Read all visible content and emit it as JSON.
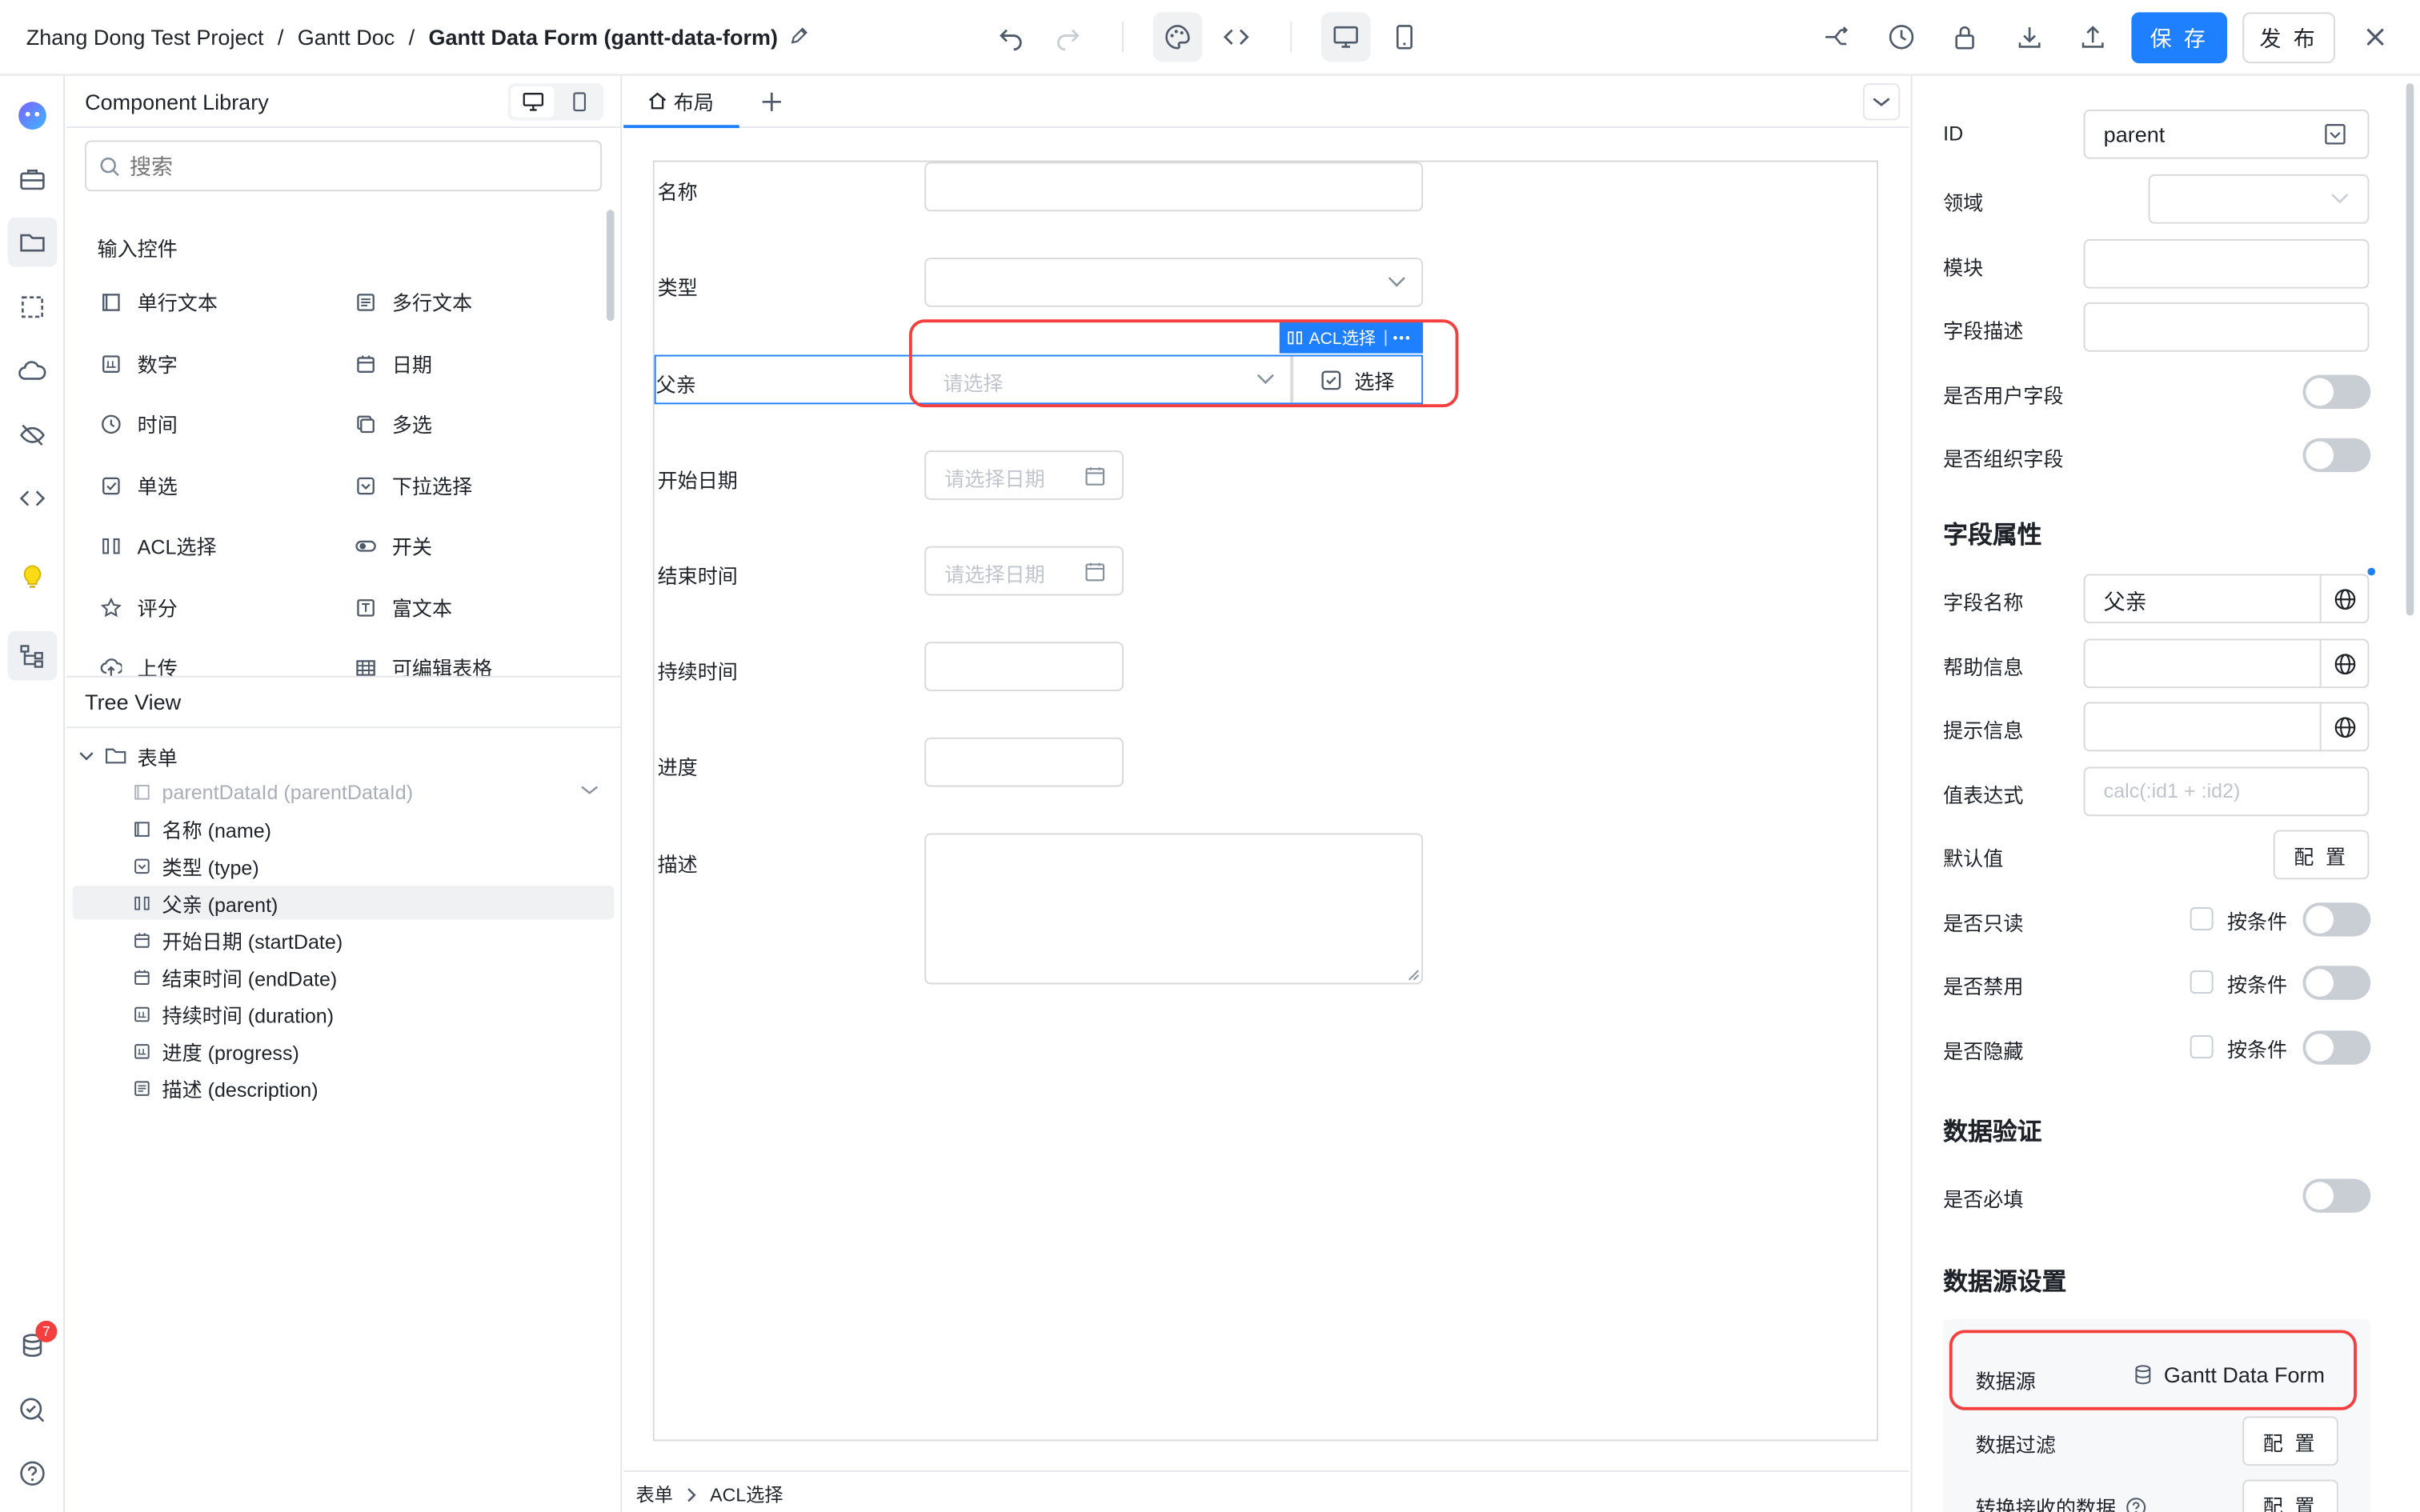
{
  "breadcrumb": {
    "project": "Zhang Dong Test Project",
    "doc": "Gantt Doc",
    "form": "Gantt Data Form (gantt-data-form)",
    "sep": "/"
  },
  "toolbar": {
    "save_label": "保 存",
    "publish_label": "发 布"
  },
  "rail": {
    "badge_count": "7"
  },
  "library": {
    "title": "Component Library",
    "search_placeholder": "搜索",
    "group_title": "输入控件",
    "components": [
      {
        "label": "单行文本",
        "icon": "single-line-text-icon"
      },
      {
        "label": "多行文本",
        "icon": "multi-line-text-icon"
      },
      {
        "label": "数字",
        "icon": "number-icon"
      },
      {
        "label": "日期",
        "icon": "calendar-icon"
      },
      {
        "label": "时间",
        "icon": "clock-icon"
      },
      {
        "label": "多选",
        "icon": "multi-select-icon"
      },
      {
        "label": "单选",
        "icon": "checkbox-icon"
      },
      {
        "label": "下拉选择",
        "icon": "dropdown-icon"
      },
      {
        "label": "ACL选择",
        "icon": "acl-icon"
      },
      {
        "label": "开关",
        "icon": "switch-icon"
      },
      {
        "label": "评分",
        "icon": "star-icon"
      },
      {
        "label": "富文本",
        "icon": "rich-text-icon"
      },
      {
        "label": "上传",
        "icon": "upload-icon"
      },
      {
        "label": "可编辑表格",
        "icon": "table-icon"
      }
    ]
  },
  "tree": {
    "title": "Tree View",
    "root": "表单",
    "nodes": [
      {
        "label": "parentDataId (parentDataId)",
        "muted": true
      },
      {
        "label": "名称 (name)"
      },
      {
        "label": "类型 (type)"
      },
      {
        "label": "父亲 (parent)",
        "selected": true
      },
      {
        "label": "开始日期 (startDate)"
      },
      {
        "label": "结束时间 (endDate)"
      },
      {
        "label": "持续时间 (duration)"
      },
      {
        "label": "进度 (progress)"
      },
      {
        "label": "描述 (description)"
      }
    ]
  },
  "canvas": {
    "tab_label": "布局",
    "fields": {
      "name": "名称",
      "type": "类型",
      "parent": "父亲",
      "start": "开始日期",
      "end": "结束时间",
      "duration": "持续时间",
      "progress": "进度",
      "desc": "描述"
    },
    "select_placeholder": "请选择",
    "date_placeholder": "请选择日期",
    "acl_tag": "ACL选择",
    "pick_label": "选择",
    "bottom_crumb": [
      "表单",
      "ACL选择"
    ]
  },
  "props": {
    "id_label": "ID",
    "id_value": "parent",
    "domain_label": "领域",
    "module_label": "模块",
    "field_desc_label": "字段描述",
    "is_user_field": "是否用户字段",
    "is_org_field": "是否组织字段",
    "section_field_attr": "字段属性",
    "field_name_label": "字段名称",
    "field_name_value": "父亲",
    "help_label": "帮助信息",
    "hint_label": "提示信息",
    "expr_label": "值表达式",
    "expr_placeholder": "calc(:id1 + :id2)",
    "default_label": "默认值",
    "config_label": "配 置",
    "readonly_label": "是否只读",
    "disabled_label": "是否禁用",
    "hidden_label": "是否隐藏",
    "by_condition": "按条件",
    "section_validation": "数据验证",
    "required_label": "是否必填",
    "section_datasource": "数据源设置",
    "datasource_label": "数据源",
    "datasource_value": "Gantt Data Form",
    "filter_label": "数据过滤",
    "transform_label": "转换接收的数据"
  },
  "colors": {
    "primary": "#1e80ff",
    "highlight": "#f53f3f"
  }
}
